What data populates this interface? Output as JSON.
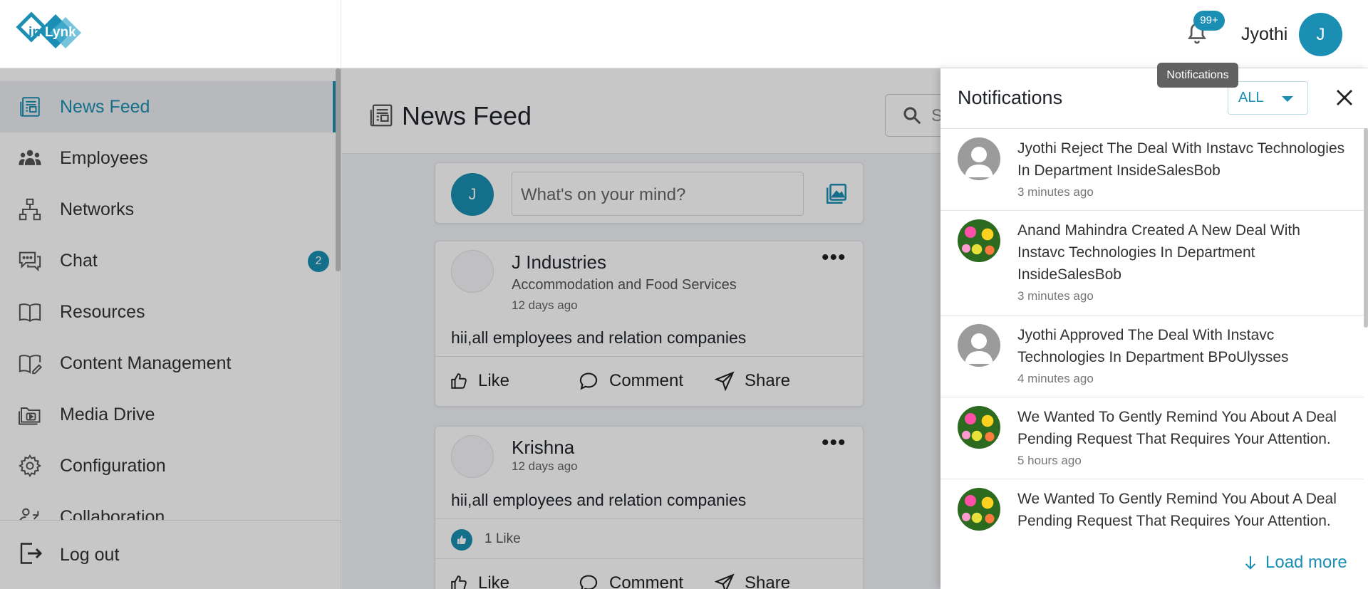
{
  "header": {
    "logo_text": "inLynk",
    "notifications_badge": "99+",
    "user_name": "Jyothi",
    "user_initial": "J",
    "tooltip": "Notifications"
  },
  "sidebar": {
    "items": [
      {
        "label": "News Feed",
        "icon": "newspaper-icon",
        "active": true
      },
      {
        "label": "Employees",
        "icon": "people-icon"
      },
      {
        "label": "Networks",
        "icon": "network-icon"
      },
      {
        "label": "Chat",
        "icon": "chat-icon",
        "badge": "2"
      },
      {
        "label": "Resources",
        "icon": "book-icon"
      },
      {
        "label": "Content Management",
        "icon": "book-edit-icon"
      },
      {
        "label": "Media Drive",
        "icon": "media-folder-icon"
      },
      {
        "label": "Configuration",
        "icon": "gear-icon"
      },
      {
        "label": "Collaboration",
        "icon": "collaboration-icon"
      }
    ],
    "logout_label": "Log out"
  },
  "page": {
    "title": "News Feed",
    "search_placeholder": "S"
  },
  "composer": {
    "avatar_initial": "J",
    "placeholder": "What's on your mind?"
  },
  "posts": [
    {
      "author": "J Industries",
      "subtitle": "Accommodation and Food Services",
      "time": "12 days ago",
      "text": "hii,all employees and relation companies",
      "actions": {
        "like": "Like",
        "comment": "Comment",
        "share": "Share"
      }
    },
    {
      "author": "Krishna",
      "time": "12 days ago",
      "text": "hii,all employees and relation companies",
      "likes": "1 Like",
      "actions": {
        "like": "Like",
        "comment": "Comment",
        "share": "Share"
      }
    }
  ],
  "notifications": {
    "title": "Notifications",
    "filter": "ALL",
    "items": [
      {
        "text": "Jyothi Reject The Deal With Instavc Technologies In Department InsideSalesBob",
        "time": "3 minutes ago",
        "avatar": "default-avatar"
      },
      {
        "text": "Anand Mahindra Created A New Deal With Instavc Technologies In Department InsideSalesBob",
        "time": "3 minutes ago",
        "avatar": "flower-photo"
      },
      {
        "text": "Jyothi Approved The Deal With Instavc Technologies In Department BPoUlysses",
        "time": "4 minutes ago",
        "avatar": "default-avatar"
      },
      {
        "text": "We Wanted To Gently Remind You About A Deal Pending Request That Requires Your Attention.",
        "time": "5 hours ago",
        "avatar": "flower-photo"
      },
      {
        "text": "We Wanted To Gently Remind You About A Deal Pending Request That Requires Your Attention.",
        "avatar": "flower-photo"
      }
    ],
    "load_more": "Load more"
  },
  "colors": {
    "accent": "#1a8fb3",
    "overlay": "rgba(0,0,0,0.22)"
  }
}
